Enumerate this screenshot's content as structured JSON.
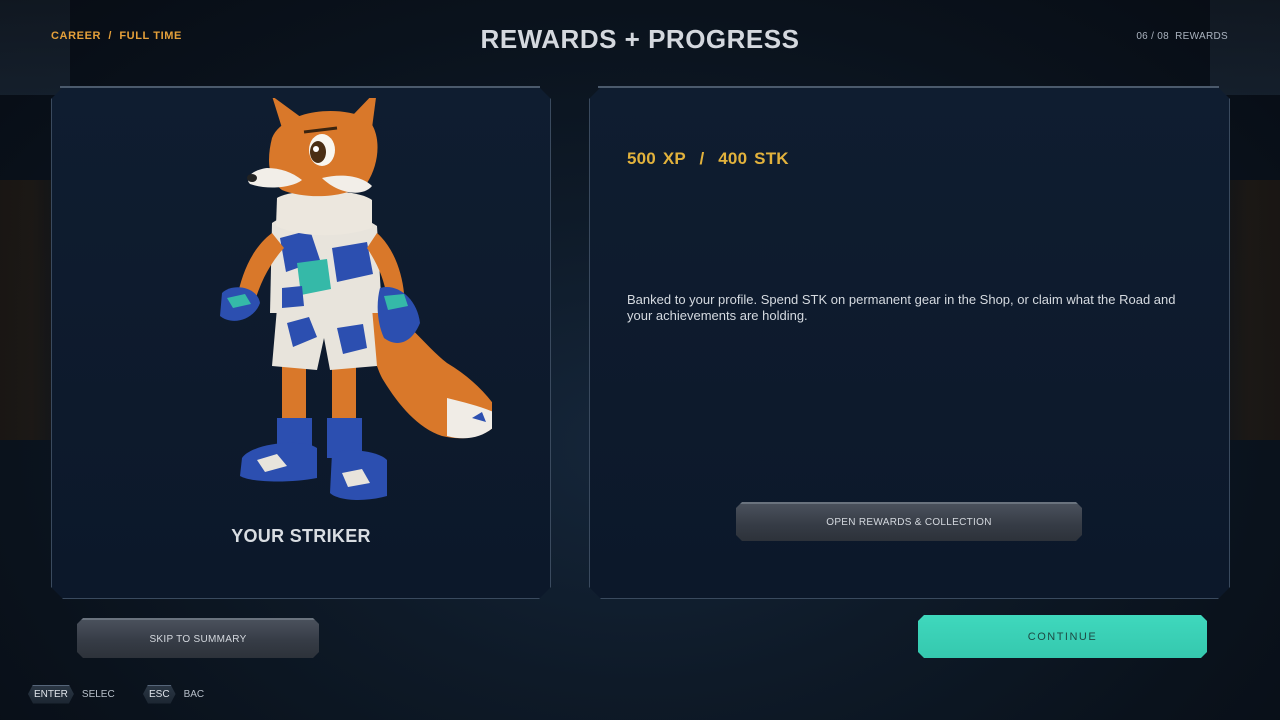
{
  "header": {
    "breadcrumb": "CAREER  /  FULL TIME",
    "title": "REWARDS + PROGRESS",
    "step_counter": "06 / 08  REWARDS"
  },
  "left_panel": {
    "character_label": "YOUR STRIKER"
  },
  "right_panel": {
    "reward_amount": "500 XP  /  400 STK",
    "description": "Banked to your profile. Spend STK on permanent gear in the Shop, or claim what the Road and your achievements are holding.",
    "open_button_label": "OPEN REWARDS & COLLECTION"
  },
  "footer": {
    "skip_label": "SKIP TO SUMMARY",
    "continue_label": "CONTINUE",
    "hints": [
      {
        "key": "ENTER",
        "action": "SELEC"
      },
      {
        "key": "ESC",
        "action": "BAC"
      }
    ]
  },
  "colors": {
    "accent_orange": "#e5a03a",
    "reward_gold": "#e2b23c",
    "continue_teal": "#3fd8bd",
    "panel_bg": "#0f1d30"
  }
}
